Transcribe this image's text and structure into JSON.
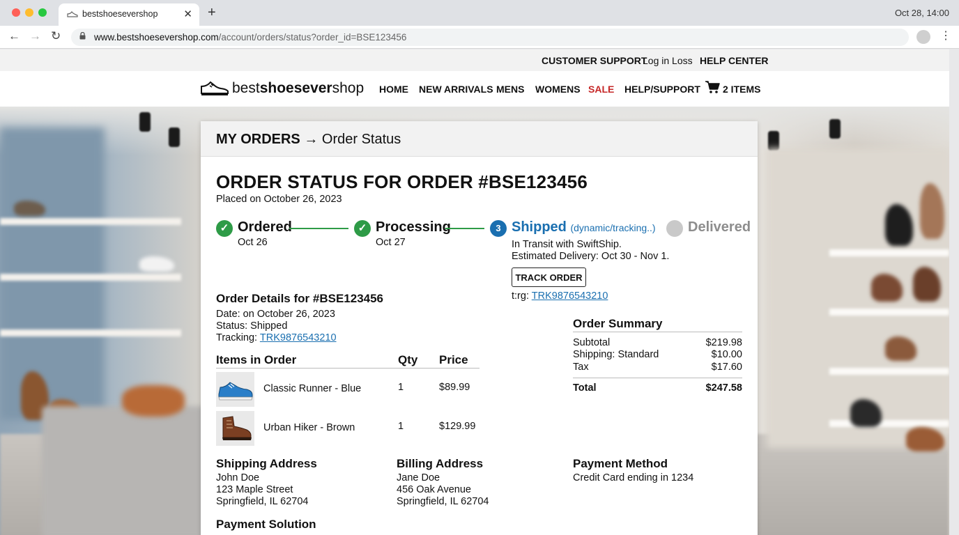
{
  "browser": {
    "tab_title": "bestshoesevershop",
    "url_host": "www.bestshoesevershop.com",
    "url_path": "/account/orders/status?order_id=BSE123456",
    "clock": "Oct 28, 14:00"
  },
  "utility_nav": {
    "customer_support": "CUSTOMER SUPPORT",
    "login": "Log in Loss",
    "help_center": "HELP CENTER"
  },
  "site": {
    "logo_prefix": "best",
    "logo_bold": "shoesever",
    "logo_suffix": "shop",
    "nav": [
      "HOME",
      "NEW ARRIVALS",
      "MENS",
      "WOMENS",
      "SALE",
      "HELP/SUPPORT"
    ],
    "cart_label": "2 ITEMS",
    "sale_color": "#c62828"
  },
  "breadcrumb": {
    "root": "MY ORDERS",
    "arrow": "→",
    "current": "Order Status"
  },
  "order": {
    "title": "ORDER STATUS FOR ORDER #BSE123456",
    "placed": "Placed on October 26, 2023",
    "steps": [
      {
        "label": "Ordered",
        "date": "Oct 26",
        "state": "done"
      },
      {
        "label": "Processing",
        "date": "Oct 27",
        "state": "done"
      },
      {
        "label": "Shipped",
        "number": "3",
        "extra": "(dynamic/tracking..)",
        "state": "current"
      },
      {
        "label": "Delivered",
        "state": "pending"
      }
    ],
    "transit_line": "In Transit with SwiftShip.",
    "estimated": "Estimated Delivery: Oct 30 - Nov 1.",
    "track_button": "TRACK ORDER",
    "tracking_prefix": "t:rg:",
    "tracking_number": "TRK9876543210"
  },
  "details": {
    "title": "Order Details for #BSE123456",
    "date_line": "Date: on October 26, 2023",
    "status_line": "Status: Shipped",
    "tracking_label": "Tracking:",
    "tracking_number": "TRK9876543210"
  },
  "items": {
    "headers": [
      "Items in Order",
      "Qty",
      "Price"
    ],
    "rows": [
      {
        "name": "Classic Runner - Blue",
        "qty": "1",
        "price": "$89.99"
      },
      {
        "name": "Urban Hiker - Brown",
        "qty": "1",
        "price": "$129.99"
      }
    ]
  },
  "summary": {
    "title": "Order Summary",
    "rows": [
      {
        "label": "Subtotal",
        "value": "$219.98"
      },
      {
        "label": "Shipping: Standard",
        "value": "$10.00"
      },
      {
        "label": "Tax",
        "value": "$17.60"
      }
    ],
    "total_label": "Total",
    "total_value": "$247.58"
  },
  "shipping": {
    "title": "Shipping Address",
    "lines": [
      "John Doe",
      "123 Maple Street",
      "Springfield, IL 62704"
    ]
  },
  "billing": {
    "title": "Billing Address",
    "lines": [
      "Jane Doe",
      "456 Oak Avenue",
      "Springfield, IL 62704"
    ]
  },
  "payment_method": {
    "title": "Payment Method",
    "line": "Credit Card ending in 1234"
  },
  "payment_solution": {
    "title": "Payment Solution"
  },
  "colors": {
    "accent_blue": "#1a6fb0",
    "done_green": "#2e9b47",
    "pending_grey": "#c9c9c9"
  }
}
